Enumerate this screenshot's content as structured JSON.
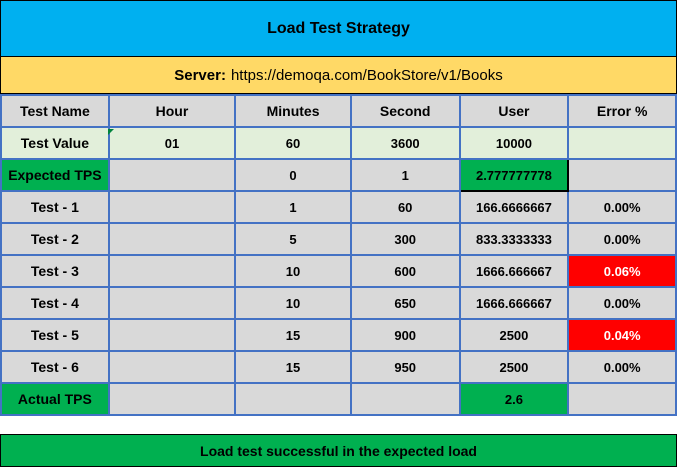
{
  "title": "Load Test Strategy",
  "server": {
    "label": "Server:",
    "url": "https://demoqa.com/BookStore/v1/Books"
  },
  "table": {
    "headers": [
      "Test Name",
      "Hour",
      "Minutes",
      "Second",
      "User",
      "Error  %"
    ],
    "rows": [
      [
        "Test Value",
        "01",
        "60",
        "3600",
        "10000",
        ""
      ],
      [
        "Expected TPS",
        "",
        "0",
        "1",
        "2.777777778",
        ""
      ],
      [
        "Test - 1",
        "",
        "1",
        "60",
        "166.6666667",
        "0.00%"
      ],
      [
        "Test - 2",
        "",
        "5",
        "300",
        "833.3333333",
        "0.00%"
      ],
      [
        "Test - 3",
        "",
        "10",
        "600",
        "1666.666667",
        "0.06%"
      ],
      [
        "Test - 4",
        "",
        "10",
        "650",
        "1666.666667",
        "0.00%"
      ],
      [
        "Test - 5",
        "",
        "15",
        "900",
        "2500",
        "0.04%"
      ],
      [
        "Test - 6",
        "",
        "15",
        "950",
        "2500",
        "0.00%"
      ],
      [
        "Actual TPS",
        "",
        "",
        "",
        "2.6",
        ""
      ]
    ]
  },
  "footer": "Load test successful in the expected load",
  "colors": {
    "title_bg": "#00b0f0",
    "server_bg": "#ffd966",
    "cell_bg": "#d9d9d9",
    "value_row_bg": "#e2efda",
    "green": "#00b050",
    "red": "#ff0000",
    "grid_border": "#4472c4"
  }
}
